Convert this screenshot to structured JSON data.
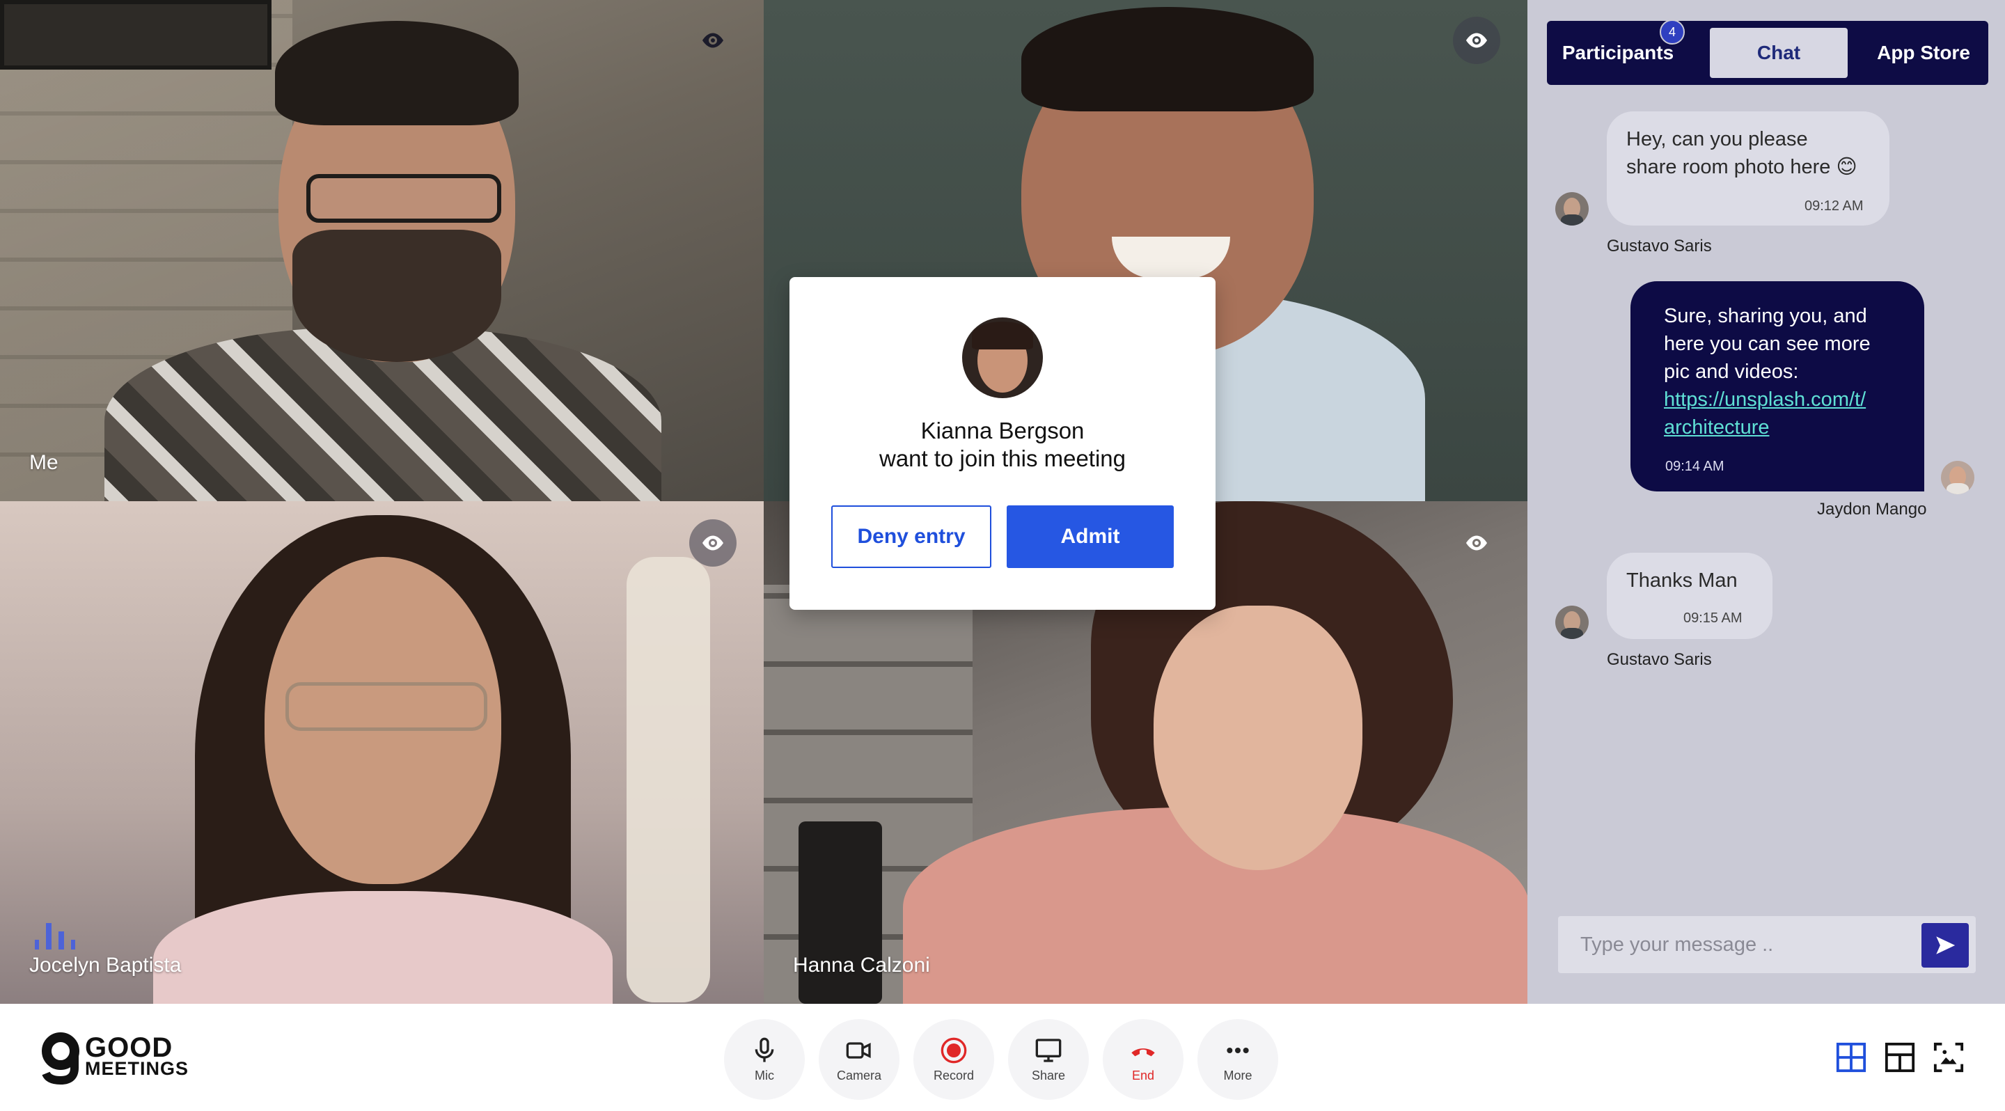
{
  "tiles": [
    {
      "name": "Me"
    },
    {
      "name": ""
    },
    {
      "name": "Jocelyn Baptista"
    },
    {
      "name": "Hanna Calzoni"
    }
  ],
  "join_request": {
    "name": "Kianna Bergson",
    "message": "want to join this meeting",
    "deny_label": "Deny entry",
    "admit_label": "Admit"
  },
  "panel": {
    "tabs": [
      {
        "label": "Participants",
        "badge": "4"
      },
      {
        "label": "Chat"
      },
      {
        "label": "App Store"
      }
    ],
    "active_tab": "Chat",
    "messages": [
      {
        "direction": "in",
        "lines": [
          "Hey, can you please",
          "share room photo here 😊"
        ],
        "time": "09:12 AM",
        "sender": "Gustavo Saris"
      },
      {
        "direction": "out",
        "lines": [
          "Sure, sharing you, and",
          "here you can see more",
          "pic and videos:"
        ],
        "link_lines": [
          "https://unsplash.com/t/",
          "architecture"
        ],
        "time": "09:14 AM",
        "sender": "Jaydon Mango"
      },
      {
        "direction": "in",
        "lines": [
          "Thanks Man"
        ],
        "time": "09:15 AM",
        "sender": "Gustavo Saris"
      }
    ],
    "composer_placeholder": "Type your message .."
  },
  "bottom": {
    "logo_top": "GOOD",
    "logo_bottom": "MEETINGS",
    "controls": [
      {
        "label": "Mic",
        "icon": "mic-icon"
      },
      {
        "label": "Camera",
        "icon": "camera-icon"
      },
      {
        "label": "Record",
        "icon": "record-icon"
      },
      {
        "label": "Share",
        "icon": "screen-share-icon"
      },
      {
        "label": "End",
        "icon": "end-call-icon"
      },
      {
        "label": "More",
        "icon": "more-icon"
      }
    ],
    "layout_icons": [
      "grid-layout-icon",
      "split-layout-icon",
      "focus-layout-icon"
    ]
  },
  "colors": {
    "accent": "#2657e3",
    "chat_dark": "#0d0b45",
    "panel_bg": "#cacad6",
    "end_red": "#e02828"
  }
}
